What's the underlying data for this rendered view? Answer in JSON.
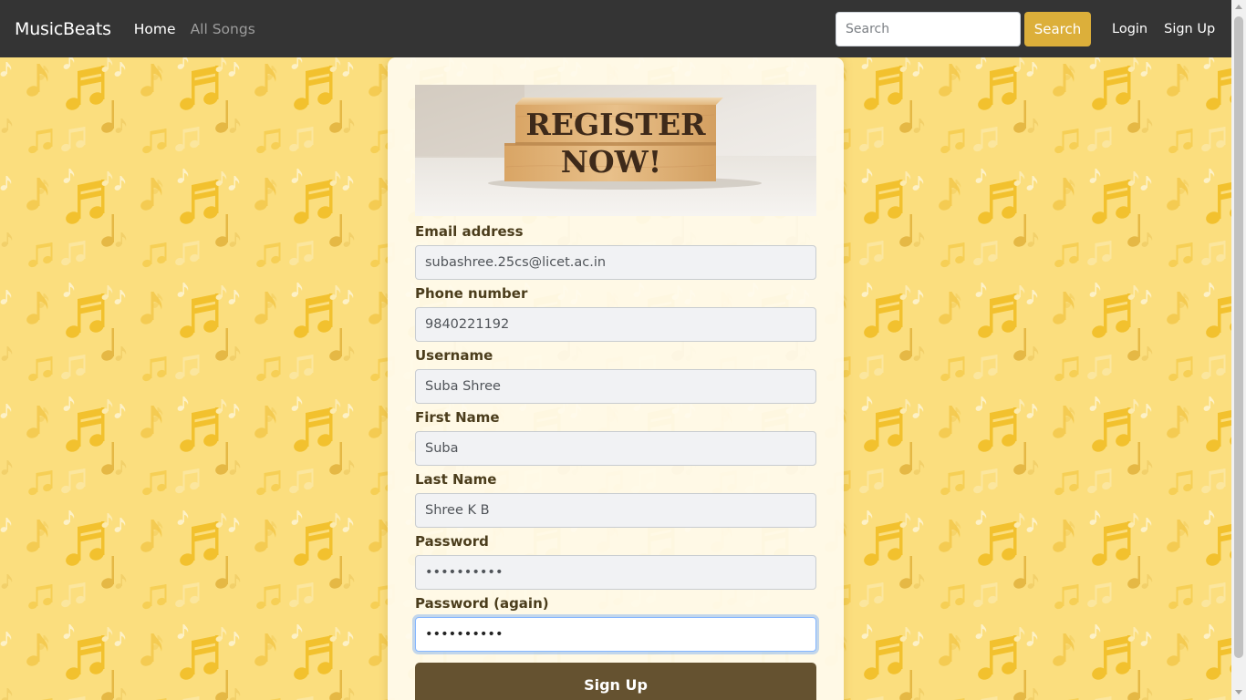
{
  "navbar": {
    "brand": "MusicBeats",
    "links": [
      {
        "label": "Home",
        "active": true
      },
      {
        "label": "All Songs",
        "active": false
      }
    ],
    "search": {
      "placeholder": "Search",
      "value": "",
      "button_label": "Search"
    },
    "auth": {
      "login_label": "Login",
      "signup_label": "Sign Up"
    }
  },
  "banner": {
    "line1": "REGISTER",
    "line2": "NOW!"
  },
  "form": {
    "fields": [
      {
        "label": "Email address",
        "value": "subashree.25cs@licet.ac.in",
        "type": "email"
      },
      {
        "label": "Phone number",
        "value": "9840221192",
        "type": "text"
      },
      {
        "label": "Username",
        "value": "Suba Shree",
        "type": "text"
      },
      {
        "label": "First Name",
        "value": "Suba",
        "type": "text"
      },
      {
        "label": "Last Name",
        "value": "Shree K B",
        "type": "text"
      },
      {
        "label": "Password",
        "value": "••••••••••",
        "type": "password"
      },
      {
        "label": "Password (again)",
        "value": "••••••••••",
        "type": "password",
        "focused": true
      }
    ],
    "submit_label": "Sign Up"
  },
  "colors": {
    "navbar_bg": "#343434",
    "page_bg": "#fbde7e",
    "note_color": "#f2c12e",
    "search_button": "#dcaf3a",
    "submit_button": "#655230",
    "label_text": "#4b3d1c"
  },
  "icons": {
    "background_pattern": "music-note-icon",
    "scroll_up": "chevron-up-icon",
    "scroll_down": "chevron-down-icon"
  }
}
